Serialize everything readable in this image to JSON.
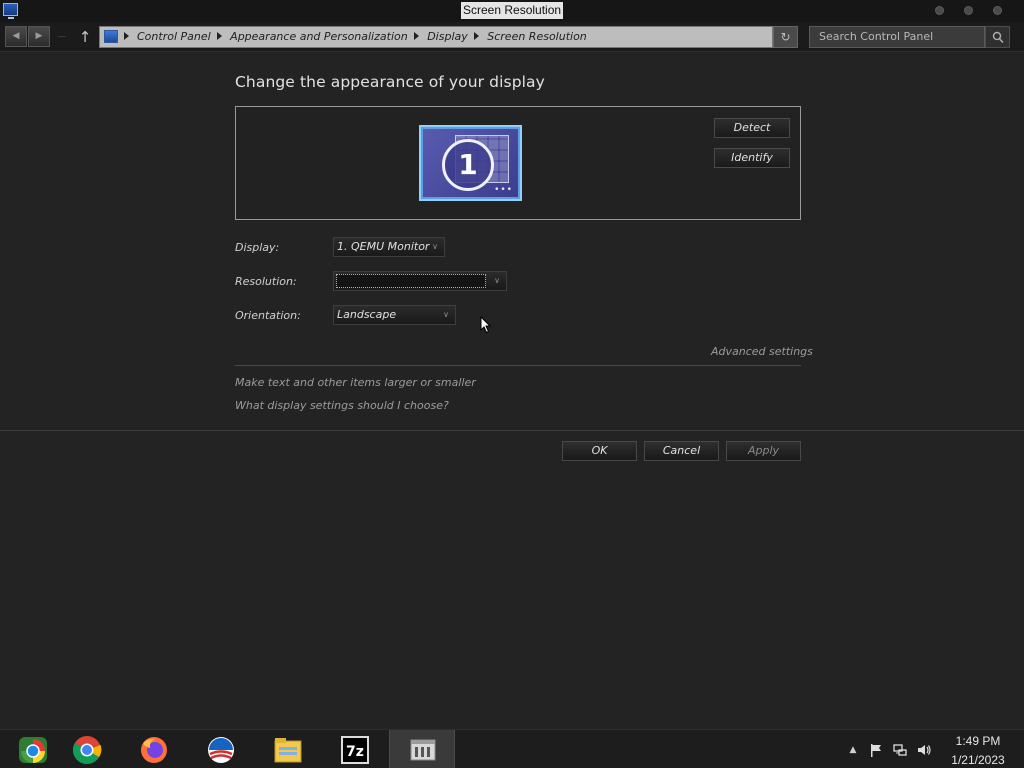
{
  "window": {
    "title": "Screen Resolution"
  },
  "navbar": {
    "breadcrumbs": [
      "Control Panel",
      "Appearance and Personalization",
      "Display",
      "Screen Resolution"
    ],
    "search_placeholder": "Search Control Panel"
  },
  "main": {
    "heading": "Change the appearance of your display",
    "monitor_number": "1",
    "detect_label": "Detect",
    "identify_label": "Identify",
    "display_label": "Display:",
    "display_value": "1. QEMU Monitor",
    "resolution_label": "Resolution:",
    "resolution_value": "",
    "orientation_label": "Orientation:",
    "orientation_value": "Landscape",
    "advanced_link": "Advanced settings",
    "links": [
      "Make text and other items larger or smaller",
      "What display settings should I choose?"
    ]
  },
  "buttons": {
    "ok": "OK",
    "cancel": "Cancel",
    "apply": "Apply"
  },
  "taskbar": {
    "apps": [
      "start-orb-icon",
      "chrome-icon",
      "firefox-icon",
      "obama-logo-icon",
      "file-explorer-icon",
      "7zip-icon",
      "control-panel-icon"
    ],
    "time": "1:49 PM",
    "date": "1/21/2023"
  },
  "colors": {
    "background": "#232323",
    "taskbar": "#1d1d1d",
    "monitor_accent": "#8fd0ff"
  }
}
